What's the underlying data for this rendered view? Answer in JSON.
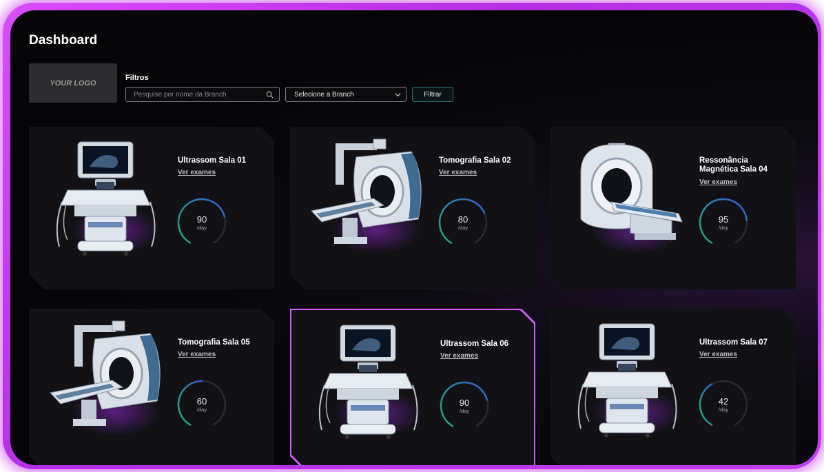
{
  "page": {
    "title": "Dashboard"
  },
  "logo": {
    "text": "YOUR LOGO"
  },
  "filters": {
    "label": "Filtros",
    "search_placeholder": "Pesquise por nome da Branch",
    "select_value": "Selecione a Branch",
    "button_label": "Filtrar"
  },
  "cards": [
    {
      "title": "Ultrassom Sala 01",
      "link": "Ver exames",
      "value": "90",
      "unit": "/day",
      "device": "ultrasound-machine",
      "gauge_fraction": 0.75
    },
    {
      "title": "Tomografia Sala 02",
      "link": "Ver exames",
      "value": "80",
      "unit": "/day",
      "device": "ct-scanner",
      "gauge_fraction": 0.72
    },
    {
      "title": "Ressonância Magnética Sala 04",
      "link": "Ver exames",
      "value": "95",
      "unit": "/day",
      "device": "mri-scanner",
      "gauge_fraction": 0.78
    },
    {
      "title": "Tomografia Sala 05",
      "link": "Ver exames",
      "value": "60",
      "unit": "/day",
      "device": "ct-scanner",
      "gauge_fraction": 0.5
    },
    {
      "title": "Ultrassom Sala 06",
      "link": "Ver exames",
      "value": "90",
      "unit": "/day",
      "device": "ultrasound-machine",
      "gauge_fraction": 0.75,
      "selected": true
    },
    {
      "title": "Ultrassom Sala 07",
      "link": "Ver exames",
      "value": "42",
      "unit": "/day",
      "device": "ultrasound-machine",
      "gauge_fraction": 0.4
    }
  ],
  "colors": {
    "accent": "#d65bff",
    "gauge_green": "#1fae6a",
    "gauge_blue": "#2e5fd8",
    "gauge_track": "#2a2a33"
  }
}
